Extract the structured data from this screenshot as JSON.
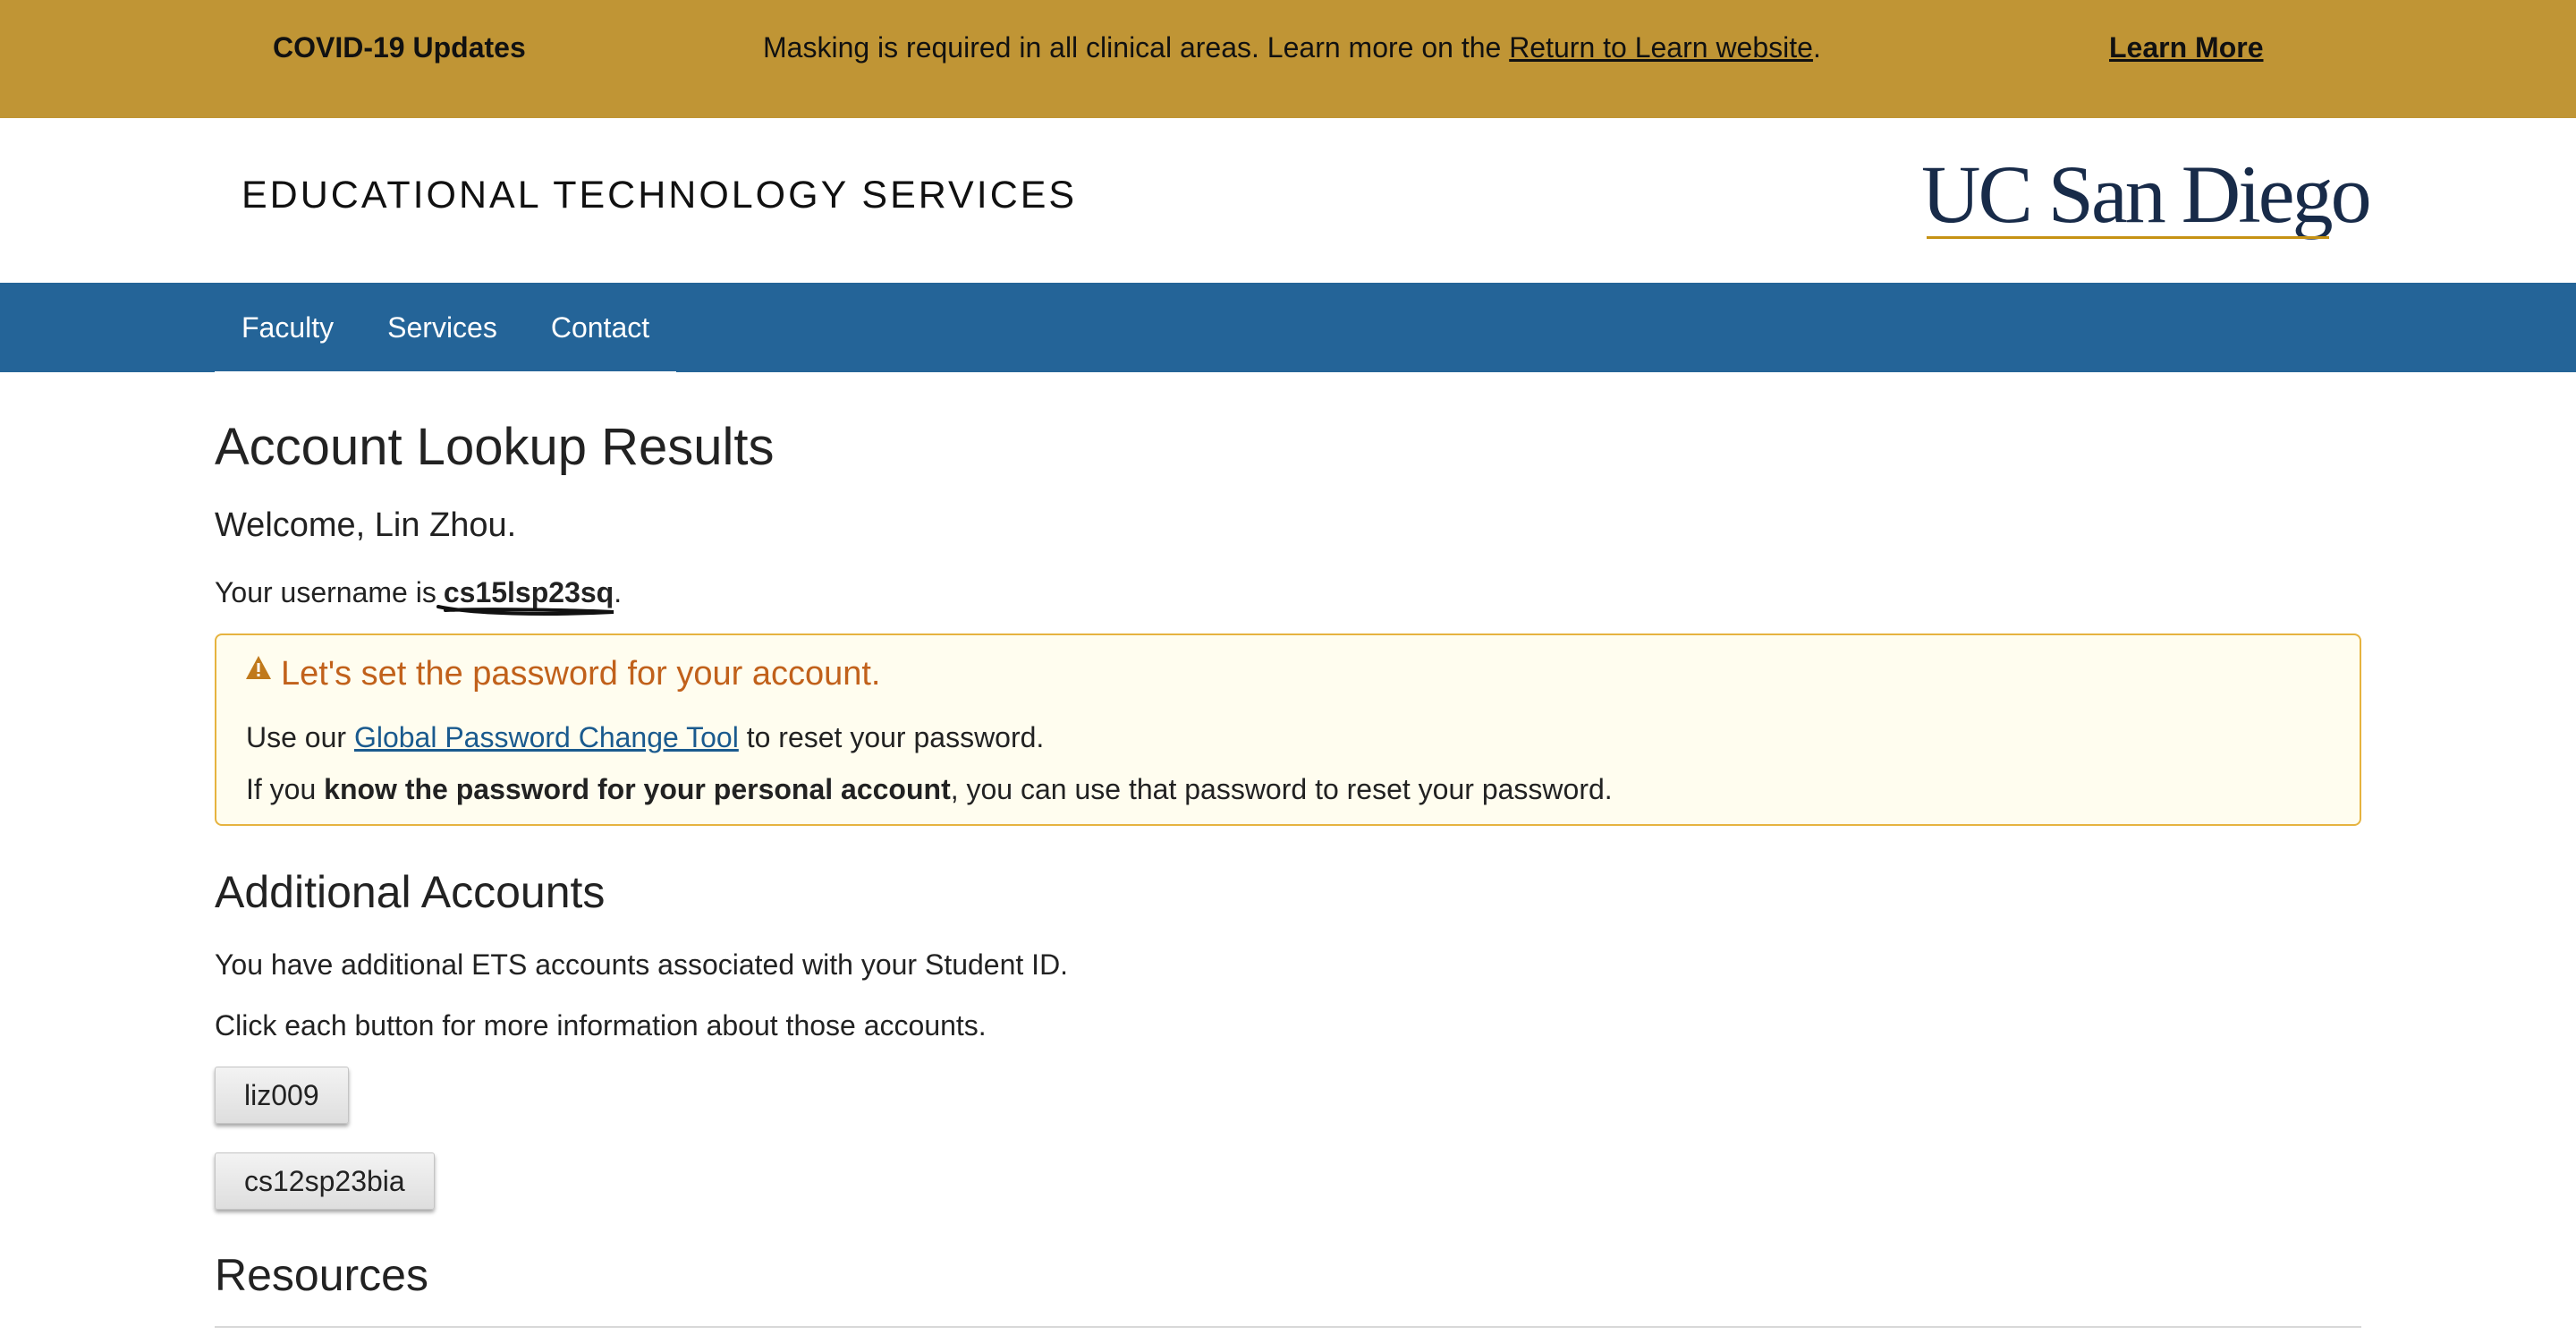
{
  "covid_banner": {
    "title": "COVID-19 Updates",
    "message_before": "Masking is required in all clinical areas. Learn more on the ",
    "message_link": "Return to Learn website",
    "message_after": ".",
    "learn_more": "Learn More"
  },
  "header": {
    "site_title": "EDUCATIONAL TECHNOLOGY SERVICES",
    "logo_text": "UC San Diego"
  },
  "nav": {
    "items": [
      {
        "label": "Faculty"
      },
      {
        "label": "Services"
      },
      {
        "label": "Contact"
      }
    ]
  },
  "main": {
    "page_title": "Account Lookup Results",
    "welcome": "Welcome, Lin Zhou.",
    "username_prefix": "Your username is",
    "username": "cs15lsp23sq",
    "username_suffix": ".",
    "alert": {
      "heading": "Let's set the password for your account.",
      "line1_before": "Use our ",
      "line1_link": "Global Password Change Tool",
      "line1_after": " to reset your password.",
      "line2_before": "If you ",
      "line2_bold": "know the password for your personal account",
      "line2_after": ", you can use that password to reset your password."
    },
    "additional_accounts": {
      "title": "Additional Accounts",
      "text1": "You have additional ETS accounts associated with your Student ID.",
      "text2": "Click each button for more information about those accounts.",
      "accounts": [
        "liz009",
        "cs12sp23bia"
      ]
    },
    "resources": {
      "title": "Resources"
    }
  },
  "colors": {
    "banner_gold": "#c09535",
    "nav_blue": "#246498",
    "alert_orange": "#c1611b",
    "alert_border": "#e6b33f",
    "link_blue": "#1a5a8e",
    "logo_navy": "#182b49"
  },
  "icons": {
    "alert": "warning-icon"
  }
}
